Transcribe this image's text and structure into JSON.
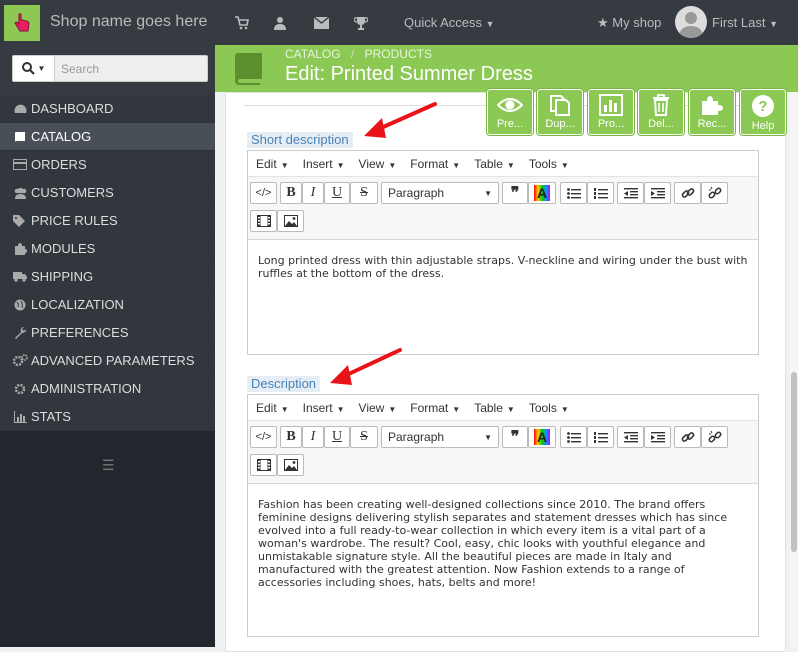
{
  "topbar": {
    "shop_name": "Shop name goes here",
    "quick_access": "Quick Access",
    "my_shop": "My shop",
    "user_name": "First Last"
  },
  "sidebar": {
    "search_placeholder": "Search",
    "items": [
      {
        "label": "DASHBOARD",
        "icon": "dashboard-icon"
      },
      {
        "label": "CATALOG",
        "icon": "book-icon"
      },
      {
        "label": "ORDERS",
        "icon": "credit-card-icon"
      },
      {
        "label": "CUSTOMERS",
        "icon": "users-icon"
      },
      {
        "label": "PRICE RULES",
        "icon": "tags-icon"
      },
      {
        "label": "MODULES",
        "icon": "puzzle-icon"
      },
      {
        "label": "SHIPPING",
        "icon": "truck-icon"
      },
      {
        "label": "LOCALIZATION",
        "icon": "globe-icon"
      },
      {
        "label": "PREFERENCES",
        "icon": "wrench-icon"
      },
      {
        "label": "ADVANCED PARAMETERS",
        "icon": "cogs-icon"
      },
      {
        "label": "ADMINISTRATION",
        "icon": "cog-icon"
      },
      {
        "label": "STATS",
        "icon": "bar-chart-icon"
      }
    ],
    "active_index": 1
  },
  "header": {
    "breadcrumb_1": "CATALOG",
    "breadcrumb_sep": "/",
    "breadcrumb_2": "PRODUCTS",
    "title": "Edit: Printed Summer Dress"
  },
  "toolbar": {
    "preview": "Pre...",
    "duplicate": "Dup...",
    "product_sales": "Pro...",
    "delete": "Del...",
    "recommended": "Rec...",
    "help": "Help"
  },
  "editor_menu": [
    "Edit",
    "Insert",
    "View",
    "Format",
    "Table",
    "Tools"
  ],
  "format_select": "Paragraph",
  "short_description": {
    "label": "Short description",
    "content": "Long printed dress with thin adjustable straps. V-neckline and wiring under the bust with ruffles at the bottom of the dress."
  },
  "description": {
    "label": "Description",
    "content": "Fashion has been creating well-designed collections since 2010. The brand offers feminine designs delivering stylish separates and statement dresses which has since evolved into a full ready-to-wear collection in which every item is a vital part of a woman's wardrobe. The result? Cool, easy, chic looks with youthful elegance and unmistakable signature style. All the beautiful pieces are made in Italy and manufactured with the greatest attention. Now Fashion extends to a range of accessories including shoes, hats, belts and more!"
  },
  "colors": {
    "accent": "#8bc954",
    "topbar": "#363a41",
    "sidebar": "#32363d",
    "annotation_arrow": "#e8141a"
  }
}
